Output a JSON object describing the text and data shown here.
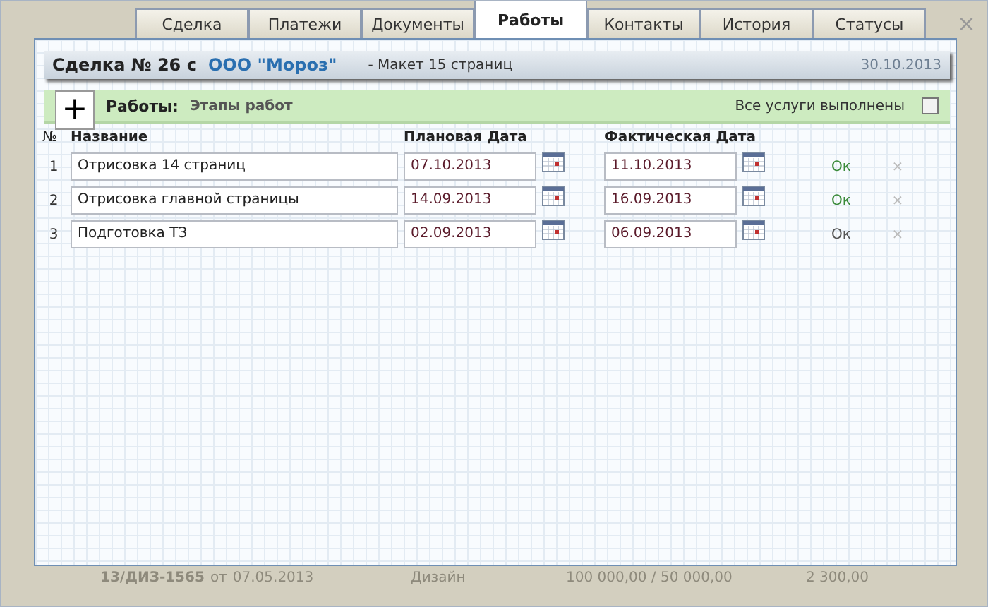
{
  "tabs": [
    {
      "label": "Сделка",
      "selected": false
    },
    {
      "label": "Платежи",
      "selected": false
    },
    {
      "label": "Документы",
      "selected": false
    },
    {
      "label": "Работы",
      "selected": true
    },
    {
      "label": "Контакты",
      "selected": false
    },
    {
      "label": "История",
      "selected": false
    },
    {
      "label": "Статусы",
      "selected": false
    }
  ],
  "close": "×",
  "deal": {
    "title": "Сделка № 26 с",
    "client": "ООО \"Мороз\"",
    "note": "- Макет 15 страниц",
    "date": "30.10.2013"
  },
  "works_bar": {
    "add": "+",
    "title": "Работы:",
    "subtitle": "Этапы работ",
    "all_done_label": "Все услуги выполнены",
    "all_done": false
  },
  "columns": [
    "№",
    "Название",
    "Плановая Дата",
    "Фактическая Дата"
  ],
  "rows": [
    {
      "number": "1",
      "name": "Отрисовка 14 страниц",
      "planned": "07.10.2013",
      "actual": "11.10.2013",
      "ok": "Ок",
      "done": true,
      "delete": "×"
    },
    {
      "number": "2",
      "name": "Отрисовка главной страницы",
      "planned": "14.09.2013",
      "actual": "16.09.2013",
      "ok": "Ок",
      "done": true,
      "delete": "×"
    },
    {
      "number": "3",
      "name": "Подготовка ТЗ",
      "planned": "02.09.2013",
      "actual": "06.09.2013",
      "ok": "Ок",
      "done": false,
      "delete": "×"
    }
  ],
  "background_row": {
    "contract": "13/ДИЗ-1565",
    "from": "от",
    "contract_date": "07.05.2013",
    "service": "Дизайн",
    "amounts": "100 000,00 / 50 000,00",
    "sum": "2 300,00"
  }
}
